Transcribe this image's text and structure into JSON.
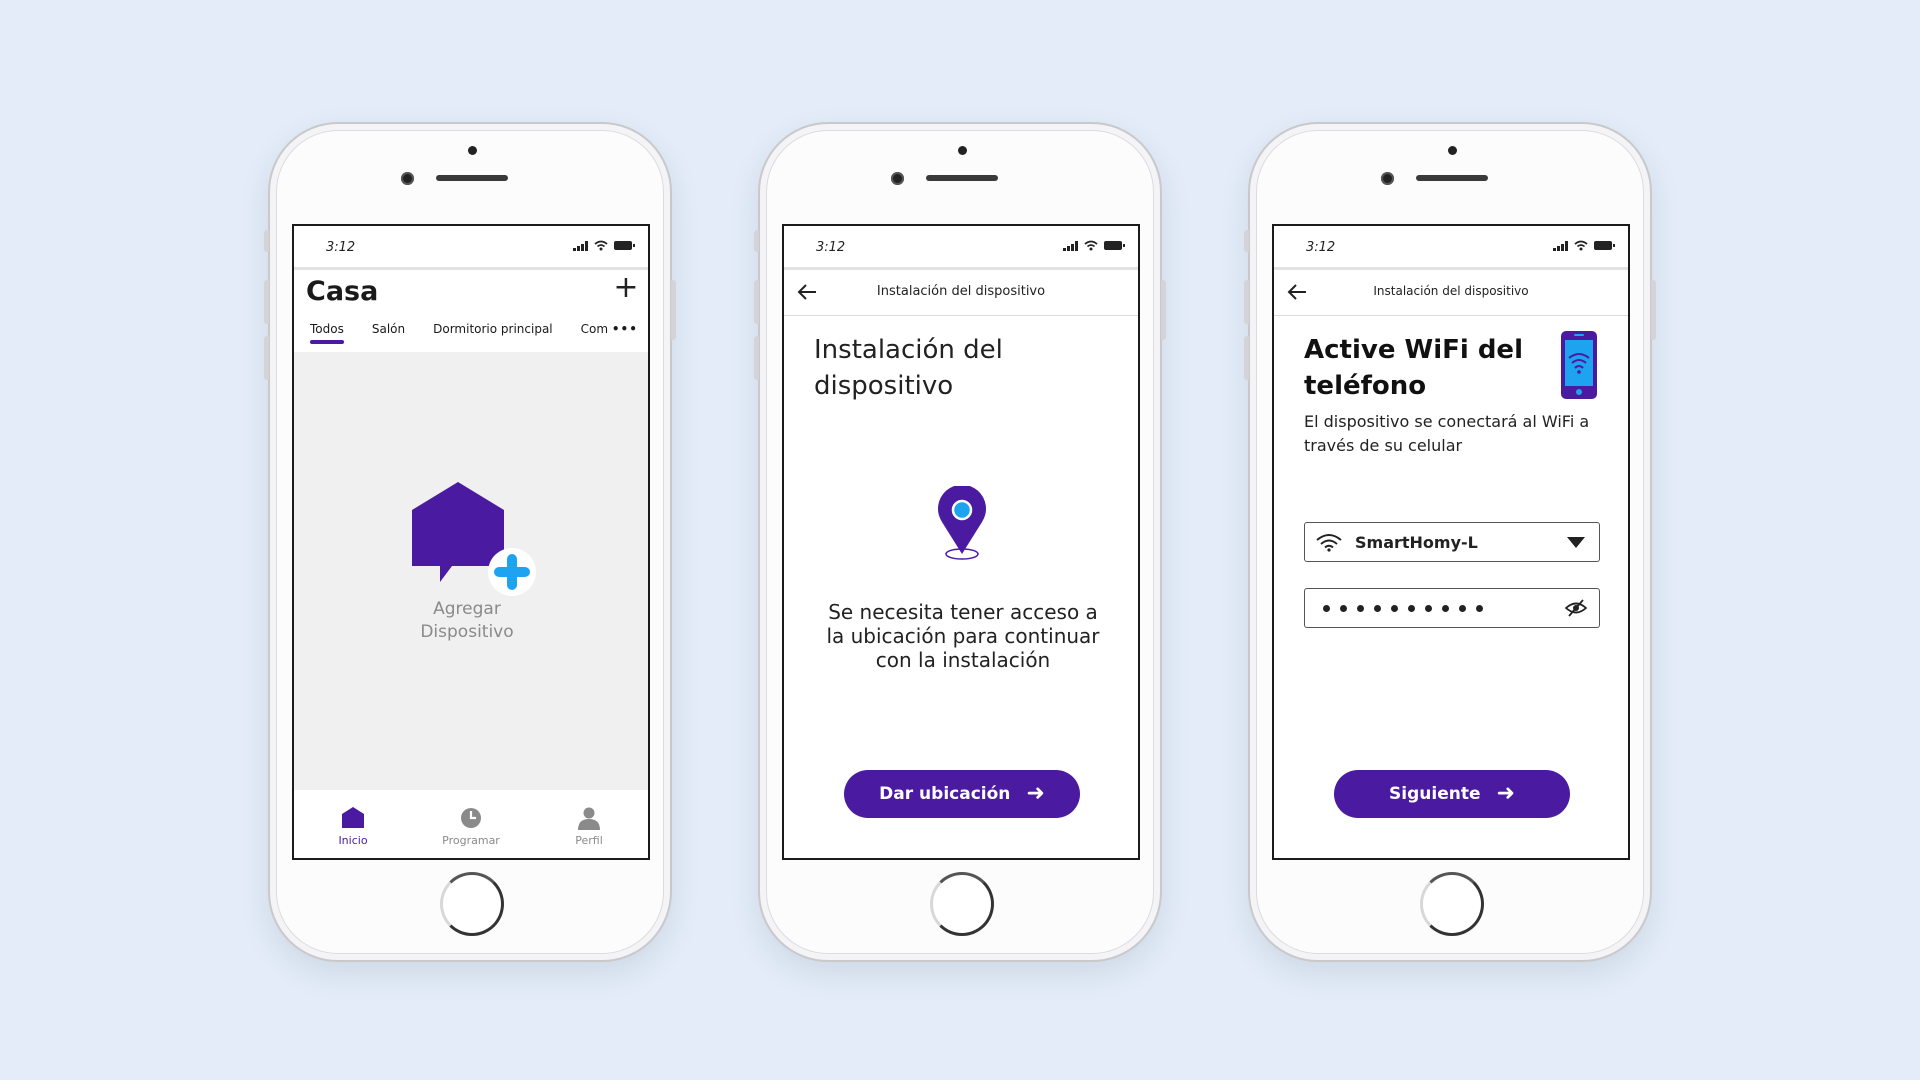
{
  "colors": {
    "brand": "#4a1aa0",
    "accent": "#1ea3f0",
    "background": "#e3ecf8"
  },
  "status_bar": {
    "time": "3:12"
  },
  "screen1": {
    "title": "Casa",
    "add_icon": "plus-icon",
    "tabs": [
      {
        "label": "Todos",
        "active": true
      },
      {
        "label": "Salón",
        "active": false
      },
      {
        "label": "Dormitorio principal",
        "active": false
      },
      {
        "label": "Com",
        "active": false
      }
    ],
    "more_tabs": "•••",
    "add_device": {
      "line1": "Agregar",
      "line2": "Dispositivo",
      "icon": "add-home-icon"
    },
    "nav": [
      {
        "label": "Inicio",
        "icon": "home-icon",
        "active": true
      },
      {
        "label": "Programar",
        "icon": "clock-icon",
        "active": false
      },
      {
        "label": "Perfil",
        "icon": "profile-icon",
        "active": false
      }
    ]
  },
  "screen2": {
    "header_title": "Instalación del dispositivo",
    "title_line1": "Instalación del",
    "title_line2": "dispositivo",
    "icon": "location-pin-icon",
    "message": "Se necesita tener acceso a la ubicación para continuar con la instalación",
    "button_label": "Dar ubicación"
  },
  "screen3": {
    "header_title": "Instalación del dispositivo",
    "title_line1": "Active WiFi del",
    "title_line2": "teléfono",
    "subtitle": "El dispositivo se conectará al WiFi a través de su celular",
    "icon": "phone-wifi-icon",
    "network_value": "SmartHomy-L",
    "password_dots": 10,
    "button_label": "Siguiente"
  }
}
